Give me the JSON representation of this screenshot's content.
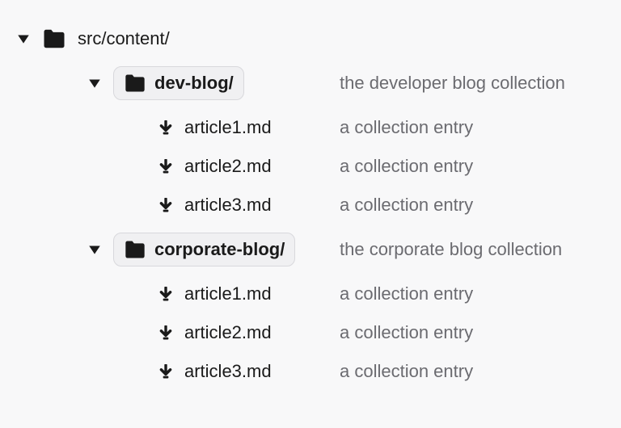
{
  "root": {
    "name": "src/content/"
  },
  "folders": [
    {
      "name": "dev-blog/",
      "desc": "the developer blog collection",
      "files": [
        {
          "name": "article1.md",
          "desc": "a collection entry"
        },
        {
          "name": "article2.md",
          "desc": "a collection entry"
        },
        {
          "name": "article3.md",
          "desc": "a collection entry"
        }
      ]
    },
    {
      "name": "corporate-blog/",
      "desc": "the corporate blog collection",
      "files": [
        {
          "name": "article1.md",
          "desc": "a collection entry"
        },
        {
          "name": "article2.md",
          "desc": "a collection entry"
        },
        {
          "name": "article3.md",
          "desc": "a collection entry"
        }
      ]
    }
  ]
}
